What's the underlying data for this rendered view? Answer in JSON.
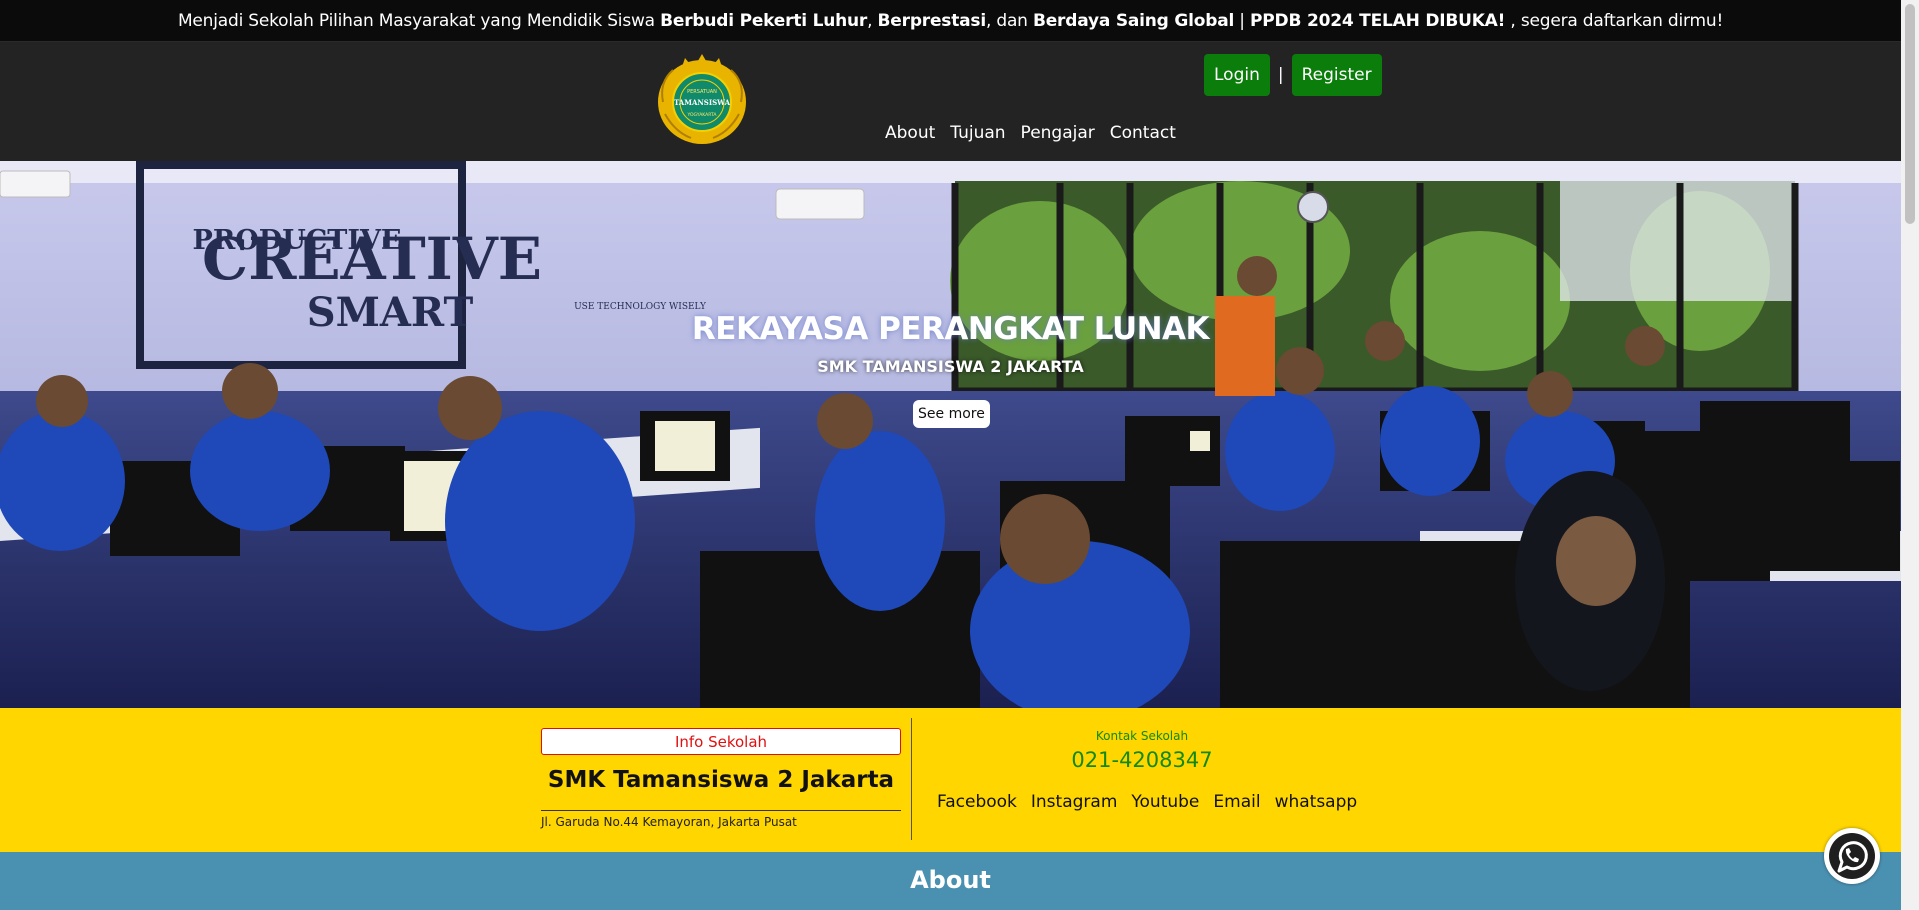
{
  "announcement": {
    "part1": "Menjadi Sekolah Pilihan Masyarakat yang Mendidik Siswa ",
    "bold1": "Berbudi Pekerti Luhur",
    "sep1": ", ",
    "bold2": "Berprestasi",
    "sep2": ", dan ",
    "bold3": "Berdaya Saing Global",
    "sep3": " | ",
    "bold4": "PPDB 2024 TELAH DIBUKA!",
    "part2": " , segera daftarkan dirmu!"
  },
  "nav": {
    "links": [
      "About",
      "Tujuan",
      "Pengajar",
      "Contact"
    ],
    "login_label": "Login",
    "separator": "|",
    "register_label": "Register"
  },
  "hero": {
    "title": "REKAYASA PERANGKAT LUNAK",
    "subtitle": "SMK TAMANSISWA 2 JAKARTA",
    "button_label": "See more",
    "wall_text": [
      "PRODUCTIVE",
      "CREATIVE",
      "SMART"
    ],
    "wall_small": "USE TECHNOLOGY WISELY"
  },
  "info": {
    "badge": "Info Sekolah",
    "school_name": "SMK Tamansiswa 2 Jakarta",
    "address": "Jl. Garuda No.44 Kemayoran, Jakarta Pusat",
    "contact_label": "Kontak Sekolah",
    "phone": "021-4208347",
    "socials": [
      "Facebook",
      "Instagram",
      "Youtube",
      "Email",
      "whatsapp"
    ]
  },
  "about": {
    "title": "About"
  },
  "logo": {
    "text_top": "PERSATUAN",
    "text_main": "TAMANSISWA",
    "text_bottom": "YOGYAKARTA"
  },
  "icons": {
    "whatsapp": "whatsapp-icon",
    "logo": "school-logo"
  },
  "colors": {
    "topbar": "#0b0b0b",
    "navbar": "#232323",
    "button_green": "#0a7d0a",
    "info_yellow": "#ffd600",
    "about_blue": "#4a90b0",
    "badge_red": "#e01010",
    "contact_green": "#128a12"
  }
}
